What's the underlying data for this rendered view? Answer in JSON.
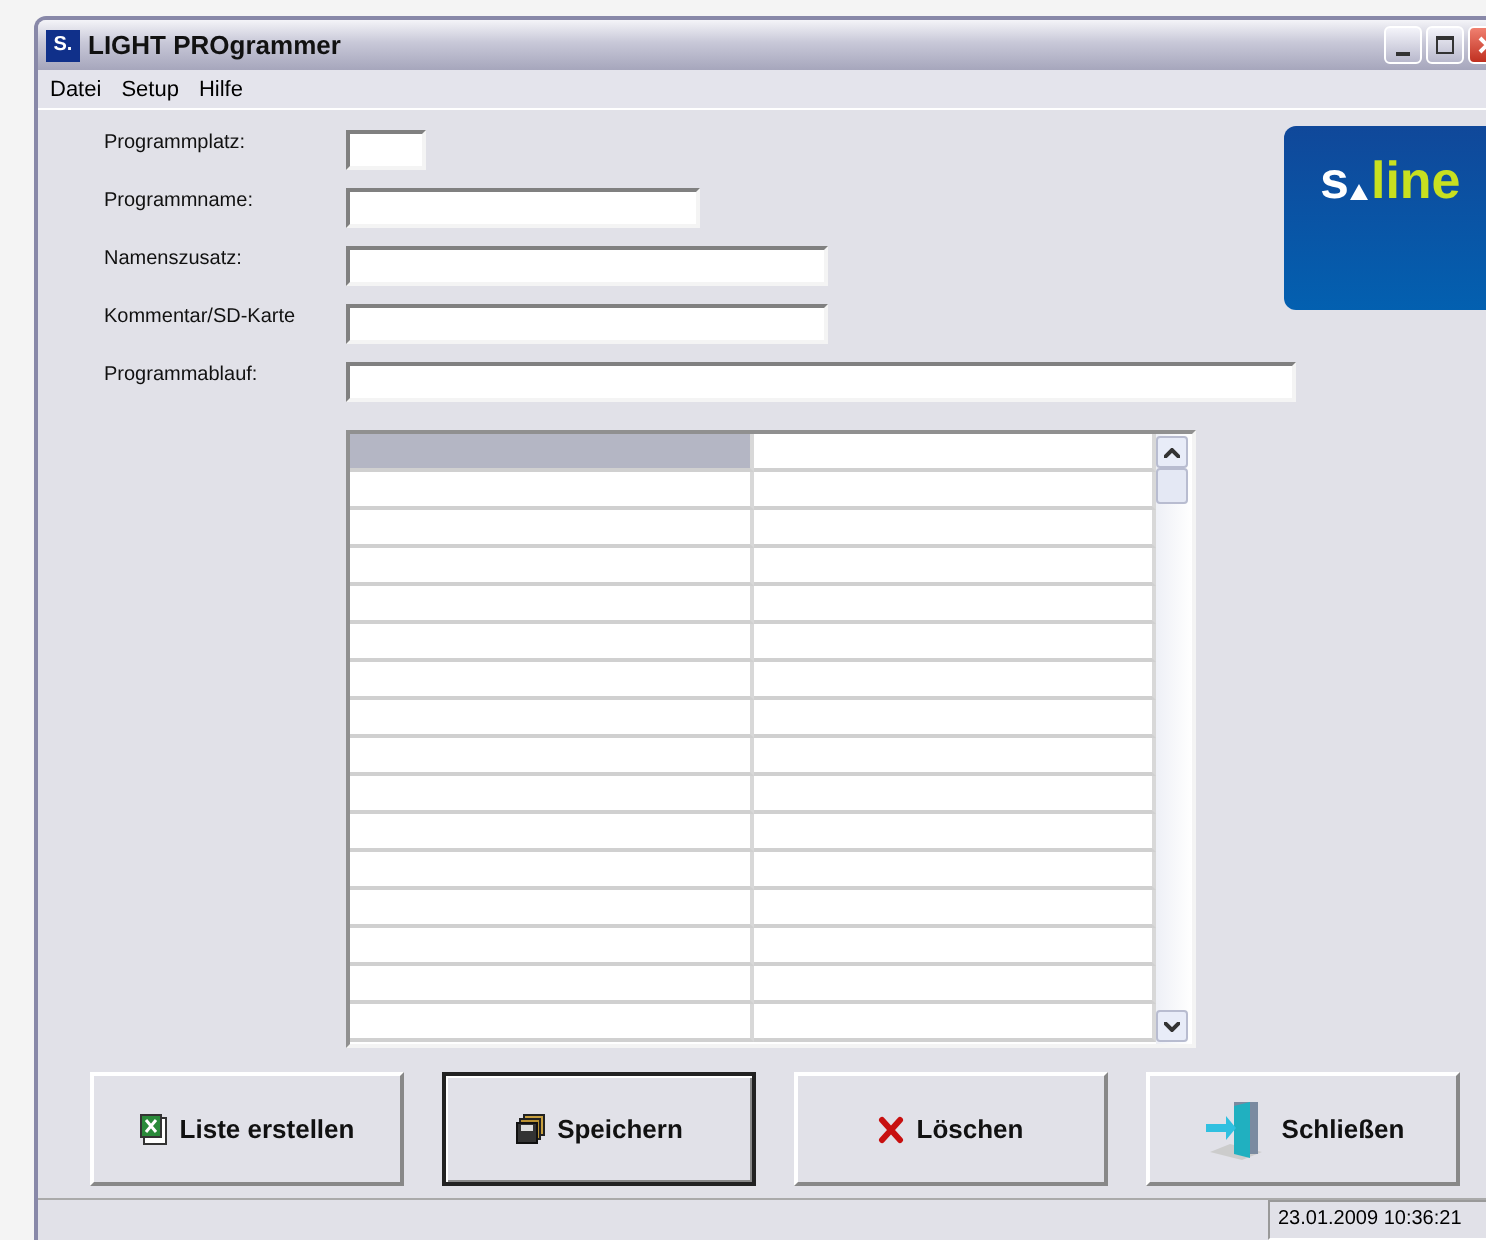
{
  "window": {
    "title": "LIGHT PROgrammer",
    "icon_text": "S."
  },
  "menu": [
    "Datei",
    "Setup",
    "Hilfe"
  ],
  "fields": [
    {
      "label": "Programmplatz:"
    },
    {
      "label": "Programmname:"
    },
    {
      "label": "Namenszusatz:"
    },
    {
      "label": "Kommentar/SD-Karte"
    },
    {
      "label": "Programmablauf:"
    }
  ],
  "logo": {
    "brand": "s",
    "suffix": "line"
  },
  "grid": {
    "rows": [
      {
        "cells": [
          {
            "selected": true
          },
          {
            "selected": false
          }
        ]
      },
      {
        "cells": [
          {
            "selected": false
          },
          {
            "selected": false
          }
        ]
      },
      {
        "cells": [
          {
            "selected": false
          },
          {
            "selected": false
          }
        ]
      },
      {
        "cells": [
          {
            "selected": false
          },
          {
            "selected": false
          }
        ]
      },
      {
        "cells": [
          {
            "selected": false
          },
          {
            "selected": false
          }
        ]
      },
      {
        "cells": [
          {
            "selected": false
          },
          {
            "selected": false
          }
        ]
      },
      {
        "cells": [
          {
            "selected": false
          },
          {
            "selected": false
          }
        ]
      },
      {
        "cells": [
          {
            "selected": false
          },
          {
            "selected": false
          }
        ]
      },
      {
        "cells": [
          {
            "selected": false
          },
          {
            "selected": false
          }
        ]
      },
      {
        "cells": [
          {
            "selected": false
          },
          {
            "selected": false
          }
        ]
      },
      {
        "cells": [
          {
            "selected": false
          },
          {
            "selected": false
          }
        ]
      },
      {
        "cells": [
          {
            "selected": false
          },
          {
            "selected": false
          }
        ]
      },
      {
        "cells": [
          {
            "selected": false
          },
          {
            "selected": false
          }
        ]
      },
      {
        "cells": [
          {
            "selected": false
          },
          {
            "selected": false
          }
        ]
      },
      {
        "cells": [
          {
            "selected": false
          },
          {
            "selected": false
          }
        ]
      },
      {
        "cells": [
          {
            "selected": false
          },
          {
            "selected": false
          }
        ]
      }
    ]
  },
  "buttons": [
    {
      "label": "Liste erstellen",
      "kind": "sheet",
      "default": false
    },
    {
      "label": "Speichern",
      "kind": "disks",
      "default": true
    },
    {
      "label": "Löschen",
      "kind": "cross",
      "default": false
    },
    {
      "label": "Schließen",
      "kind": "door",
      "default": false
    }
  ],
  "status_bar": {
    "datetime": "23.01.2009 10:36:21"
  }
}
